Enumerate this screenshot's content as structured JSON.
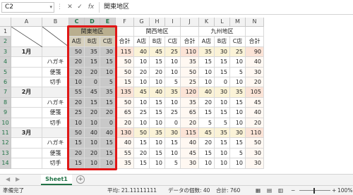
{
  "formula_bar": {
    "name_box": "C2",
    "cancel_symbol": "✕",
    "enter_symbol": "✓",
    "fx_symbol": "fx",
    "formula_value": "関東地区"
  },
  "columns": [
    "A",
    "B",
    "C",
    "D",
    "E",
    "F",
    "G",
    "H",
    "I",
    "J",
    "K",
    "L",
    "M",
    "N"
  ],
  "rows": [
    "1",
    "2",
    "3",
    "4",
    "5",
    "6",
    "7",
    "8",
    "9",
    "10",
    "11",
    "12",
    "13",
    "14"
  ],
  "regions": [
    "関東地区",
    "関西地区",
    "九州地区"
  ],
  "store_headers": [
    "A店",
    "B店",
    "C店",
    "合計"
  ],
  "months": [
    "1月",
    "2月",
    "3月"
  ],
  "products": [
    "ハガキ",
    "便箋",
    "切手"
  ],
  "table": [
    [
      50,
      35,
      30,
      115,
      40,
      45,
      25,
      110,
      35,
      30,
      25,
      90
    ],
    [
      20,
      15,
      15,
      50,
      10,
      15,
      10,
      35,
      15,
      15,
      10,
      40
    ],
    [
      20,
      20,
      10,
      50,
      20,
      20,
      10,
      50,
      10,
      15,
      5,
      30
    ],
    [
      10,
      0,
      5,
      15,
      10,
      10,
      5,
      25,
      10,
      0,
      10,
      20
    ],
    [
      55,
      45,
      35,
      135,
      45,
      40,
      35,
      120,
      40,
      30,
      35,
      105
    ],
    [
      20,
      15,
      15,
      50,
      10,
      15,
      10,
      35,
      20,
      10,
      15,
      45
    ],
    [
      25,
      20,
      20,
      65,
      25,
      15,
      25,
      65,
      15,
      15,
      10,
      40
    ],
    [
      10,
      10,
      0,
      20,
      10,
      10,
      0,
      20,
      5,
      5,
      10,
      20
    ],
    [
      50,
      40,
      40,
      130,
      50,
      35,
      30,
      115,
      45,
      35,
      30,
      110
    ],
    [
      15,
      10,
      15,
      40,
      15,
      10,
      15,
      40,
      20,
      15,
      15,
      50
    ],
    [
      20,
      20,
      15,
      55,
      20,
      15,
      10,
      45,
      15,
      10,
      5,
      30
    ],
    [
      15,
      10,
      10,
      35,
      15,
      10,
      5,
      30,
      10,
      10,
      10,
      30
    ]
  ],
  "sheet_tab": "Sheet1",
  "tab_nav": {
    "prev": "◀",
    "next": "▶",
    "add": "+"
  },
  "status": {
    "ready": "準備完了",
    "average": "平均: 21.11111111",
    "count": "データの個数: 40",
    "sum": "合計: 760",
    "zoom": "100%"
  },
  "colors": {
    "selection_border": "#e01616",
    "selection_fill": "#c8c8c8",
    "header_tan": "#c9bfa0",
    "subtotal_gold": "#fbf3d7",
    "total_pink": "#fbe3d6",
    "excel_green": "#217346"
  }
}
